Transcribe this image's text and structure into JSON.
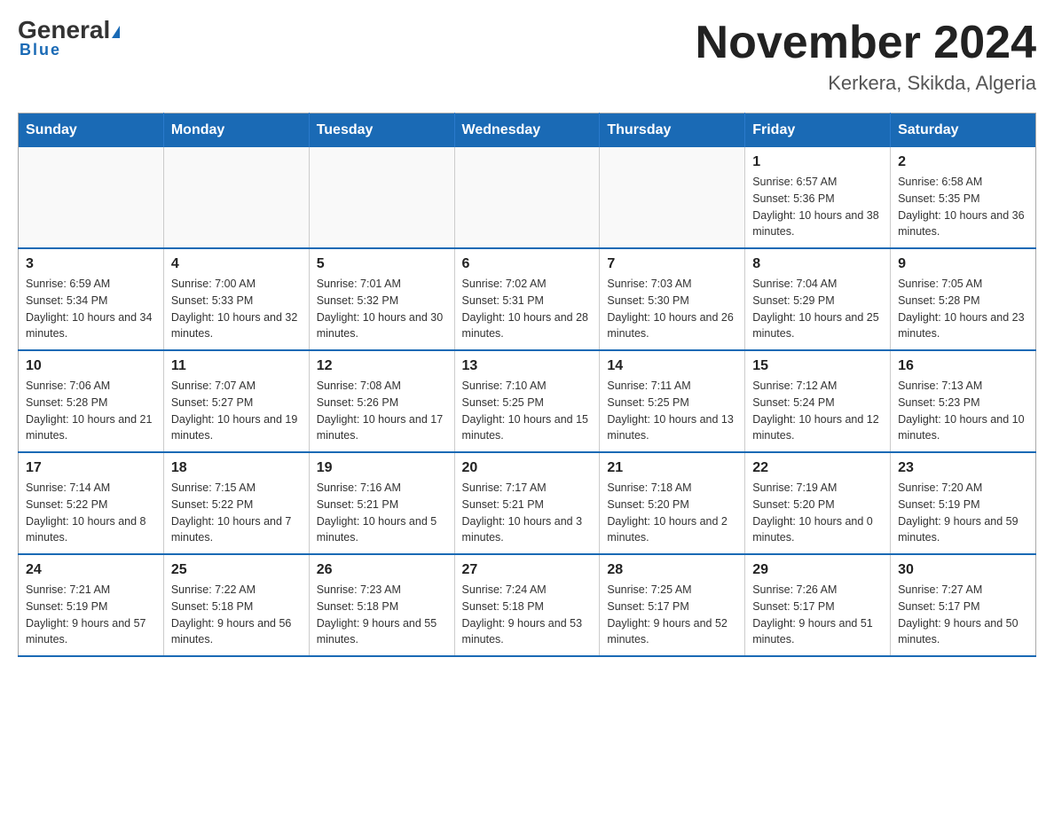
{
  "header": {
    "logo_main": "General",
    "logo_sub": "Blue",
    "month_title": "November 2024",
    "location": "Kerkera, Skikda, Algeria"
  },
  "days_of_week": [
    "Sunday",
    "Monday",
    "Tuesday",
    "Wednesday",
    "Thursday",
    "Friday",
    "Saturday"
  ],
  "weeks": [
    {
      "days": [
        {
          "num": "",
          "info": ""
        },
        {
          "num": "",
          "info": ""
        },
        {
          "num": "",
          "info": ""
        },
        {
          "num": "",
          "info": ""
        },
        {
          "num": "",
          "info": ""
        },
        {
          "num": "1",
          "info": "Sunrise: 6:57 AM\nSunset: 5:36 PM\nDaylight: 10 hours and 38 minutes."
        },
        {
          "num": "2",
          "info": "Sunrise: 6:58 AM\nSunset: 5:35 PM\nDaylight: 10 hours and 36 minutes."
        }
      ]
    },
    {
      "days": [
        {
          "num": "3",
          "info": "Sunrise: 6:59 AM\nSunset: 5:34 PM\nDaylight: 10 hours and 34 minutes."
        },
        {
          "num": "4",
          "info": "Sunrise: 7:00 AM\nSunset: 5:33 PM\nDaylight: 10 hours and 32 minutes."
        },
        {
          "num": "5",
          "info": "Sunrise: 7:01 AM\nSunset: 5:32 PM\nDaylight: 10 hours and 30 minutes."
        },
        {
          "num": "6",
          "info": "Sunrise: 7:02 AM\nSunset: 5:31 PM\nDaylight: 10 hours and 28 minutes."
        },
        {
          "num": "7",
          "info": "Sunrise: 7:03 AM\nSunset: 5:30 PM\nDaylight: 10 hours and 26 minutes."
        },
        {
          "num": "8",
          "info": "Sunrise: 7:04 AM\nSunset: 5:29 PM\nDaylight: 10 hours and 25 minutes."
        },
        {
          "num": "9",
          "info": "Sunrise: 7:05 AM\nSunset: 5:28 PM\nDaylight: 10 hours and 23 minutes."
        }
      ]
    },
    {
      "days": [
        {
          "num": "10",
          "info": "Sunrise: 7:06 AM\nSunset: 5:28 PM\nDaylight: 10 hours and 21 minutes."
        },
        {
          "num": "11",
          "info": "Sunrise: 7:07 AM\nSunset: 5:27 PM\nDaylight: 10 hours and 19 minutes."
        },
        {
          "num": "12",
          "info": "Sunrise: 7:08 AM\nSunset: 5:26 PM\nDaylight: 10 hours and 17 minutes."
        },
        {
          "num": "13",
          "info": "Sunrise: 7:10 AM\nSunset: 5:25 PM\nDaylight: 10 hours and 15 minutes."
        },
        {
          "num": "14",
          "info": "Sunrise: 7:11 AM\nSunset: 5:25 PM\nDaylight: 10 hours and 13 minutes."
        },
        {
          "num": "15",
          "info": "Sunrise: 7:12 AM\nSunset: 5:24 PM\nDaylight: 10 hours and 12 minutes."
        },
        {
          "num": "16",
          "info": "Sunrise: 7:13 AM\nSunset: 5:23 PM\nDaylight: 10 hours and 10 minutes."
        }
      ]
    },
    {
      "days": [
        {
          "num": "17",
          "info": "Sunrise: 7:14 AM\nSunset: 5:22 PM\nDaylight: 10 hours and 8 minutes."
        },
        {
          "num": "18",
          "info": "Sunrise: 7:15 AM\nSunset: 5:22 PM\nDaylight: 10 hours and 7 minutes."
        },
        {
          "num": "19",
          "info": "Sunrise: 7:16 AM\nSunset: 5:21 PM\nDaylight: 10 hours and 5 minutes."
        },
        {
          "num": "20",
          "info": "Sunrise: 7:17 AM\nSunset: 5:21 PM\nDaylight: 10 hours and 3 minutes."
        },
        {
          "num": "21",
          "info": "Sunrise: 7:18 AM\nSunset: 5:20 PM\nDaylight: 10 hours and 2 minutes."
        },
        {
          "num": "22",
          "info": "Sunrise: 7:19 AM\nSunset: 5:20 PM\nDaylight: 10 hours and 0 minutes."
        },
        {
          "num": "23",
          "info": "Sunrise: 7:20 AM\nSunset: 5:19 PM\nDaylight: 9 hours and 59 minutes."
        }
      ]
    },
    {
      "days": [
        {
          "num": "24",
          "info": "Sunrise: 7:21 AM\nSunset: 5:19 PM\nDaylight: 9 hours and 57 minutes."
        },
        {
          "num": "25",
          "info": "Sunrise: 7:22 AM\nSunset: 5:18 PM\nDaylight: 9 hours and 56 minutes."
        },
        {
          "num": "26",
          "info": "Sunrise: 7:23 AM\nSunset: 5:18 PM\nDaylight: 9 hours and 55 minutes."
        },
        {
          "num": "27",
          "info": "Sunrise: 7:24 AM\nSunset: 5:18 PM\nDaylight: 9 hours and 53 minutes."
        },
        {
          "num": "28",
          "info": "Sunrise: 7:25 AM\nSunset: 5:17 PM\nDaylight: 9 hours and 52 minutes."
        },
        {
          "num": "29",
          "info": "Sunrise: 7:26 AM\nSunset: 5:17 PM\nDaylight: 9 hours and 51 minutes."
        },
        {
          "num": "30",
          "info": "Sunrise: 7:27 AM\nSunset: 5:17 PM\nDaylight: 9 hours and 50 minutes."
        }
      ]
    }
  ]
}
